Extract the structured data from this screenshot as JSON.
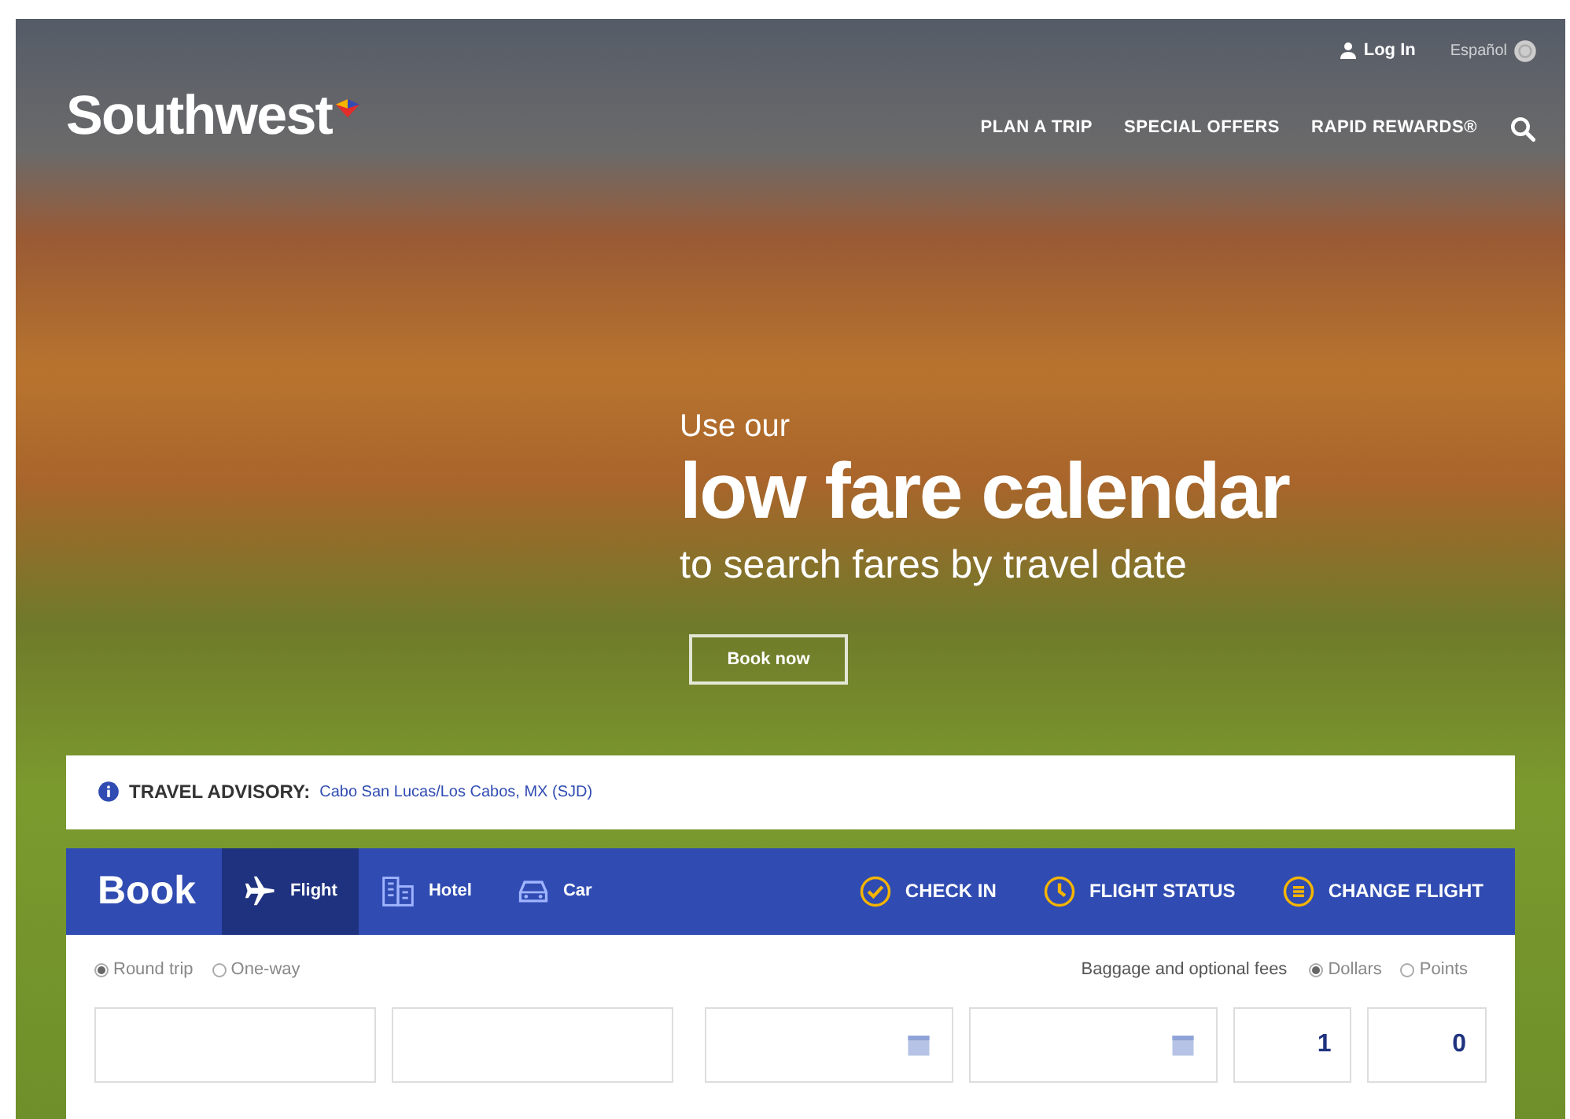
{
  "header": {
    "logo": "Southwest",
    "utility_links": [
      {
        "label": "Log In",
        "kind": "login"
      },
      {
        "label": "Español",
        "kind": "language"
      }
    ],
    "nav": [
      "PLAN A TRIP",
      "SPECIAL OFFERS",
      "RAPID REWARDS®"
    ]
  },
  "hero": {
    "eyebrow": "Use our",
    "headline": "low fare calendar",
    "subline": "to search fares by travel date",
    "button": "Book now"
  },
  "advisory": {
    "label": "TRAVEL ADVISORY:",
    "link": "Cabo San Lucas/Los Cabos, MX (SJD)"
  },
  "booking": {
    "title": "Book",
    "tabs": [
      {
        "label": "Flight",
        "kind": "flight",
        "selected": true
      },
      {
        "label": "Hotel",
        "kind": "hotel",
        "selected": false
      },
      {
        "label": "Car",
        "kind": "car",
        "selected": false
      }
    ],
    "actions": [
      {
        "label": "CHECK IN",
        "kind": "check"
      },
      {
        "label": "FLIGHT STATUS",
        "kind": "clock"
      },
      {
        "label": "CHANGE FLIGHT",
        "kind": "change"
      }
    ],
    "trip_types": [
      {
        "label": "Round trip",
        "selected": true
      },
      {
        "label": "One-way",
        "selected": false
      }
    ],
    "fees_link": "Baggage and optional fees",
    "fare_types": [
      {
        "label": "Dollars",
        "selected": true
      },
      {
        "label": "Points",
        "selected": false
      }
    ],
    "fields": [
      {
        "kind": "airport"
      },
      {
        "kind": "airport"
      },
      {
        "kind": "date"
      },
      {
        "kind": "date"
      },
      {
        "kind": "count",
        "value": "1"
      },
      {
        "kind": "count",
        "value": "0"
      }
    ]
  }
}
